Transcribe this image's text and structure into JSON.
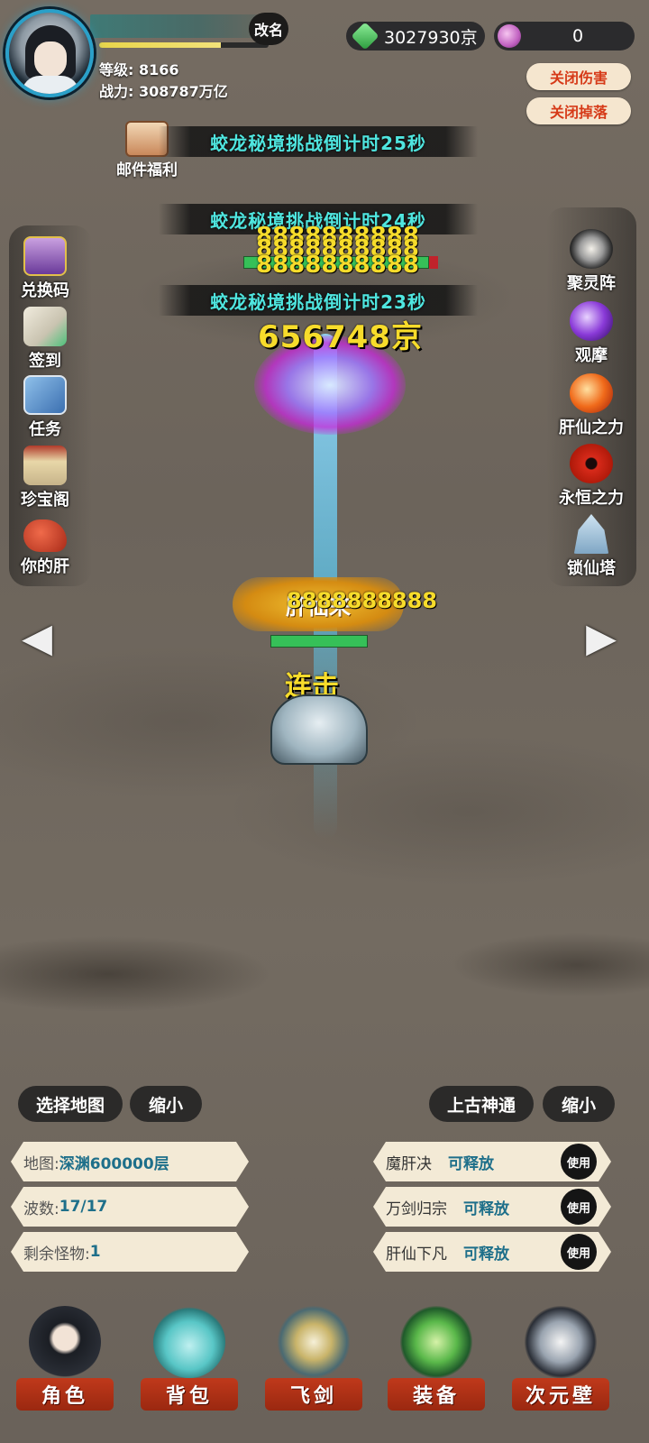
{
  "player": {
    "rename": "改名",
    "level": "等级: 8166",
    "power": "战力: 308787万亿",
    "xp_fraction": 0.72
  },
  "currency": {
    "gems": "3027930京",
    "orbs": "0"
  },
  "toggles": {
    "damage": "关闭伤害",
    "drops": "关闭掉落"
  },
  "mail": {
    "label": "邮件福利"
  },
  "banners": [
    "蛟龙秘境挑战倒计时25秒",
    "蛟龙秘境挑战倒计时24秒",
    "蛟龙秘境挑战倒计时23秒"
  ],
  "left_menu": [
    {
      "label": "兑换码",
      "icon": "chest-icon"
    },
    {
      "label": "签到",
      "icon": "scroll-icon"
    },
    {
      "label": "任务",
      "icon": "task-scroll-icon"
    },
    {
      "label": "珍宝阁",
      "icon": "pavilion-icon"
    },
    {
      "label": "你的肝",
      "icon": "liver-icon"
    }
  ],
  "right_menu": [
    {
      "label": "聚灵阵",
      "icon": "array-icon"
    },
    {
      "label": "观摩",
      "icon": "purple-orb-icon"
    },
    {
      "label": "肝仙之力",
      "icon": "fire-orb-icon"
    },
    {
      "label": "永恒之力",
      "icon": "sharingan-icon"
    },
    {
      "label": "锁仙塔",
      "icon": "tower-icon"
    }
  ],
  "battle": {
    "big_damage": "656748京",
    "skill_name": "肝仙来",
    "combo": "连击",
    "damage_stack": "8888888888"
  },
  "map_controls": {
    "select_map": "选择地图",
    "shrink_left": "缩小",
    "ancient": "上古神通",
    "shrink_right": "缩小"
  },
  "stats": {
    "map_key": "地图: ",
    "map_val": "深渊600000层",
    "wave_key": "波数:",
    "wave_val": "17/17",
    "remain_key": "剩余怪物:",
    "remain_val": "1"
  },
  "skills": [
    {
      "name": "魔肝决",
      "status": "可释放",
      "use": "使用"
    },
    {
      "name": "万剑归宗",
      "status": "可释放",
      "use": "使用"
    },
    {
      "name": "肝仙下凡",
      "status": "可释放",
      "use": "使用"
    }
  ],
  "nav": [
    {
      "label": "角色",
      "icon": "character-icon"
    },
    {
      "label": "背包",
      "icon": "bag-icon"
    },
    {
      "label": "飞剑",
      "icon": "flying-sword-icon"
    },
    {
      "label": "装备",
      "icon": "dragon-equip-icon"
    },
    {
      "label": "次元壁",
      "icon": "dimension-icon"
    }
  ]
}
